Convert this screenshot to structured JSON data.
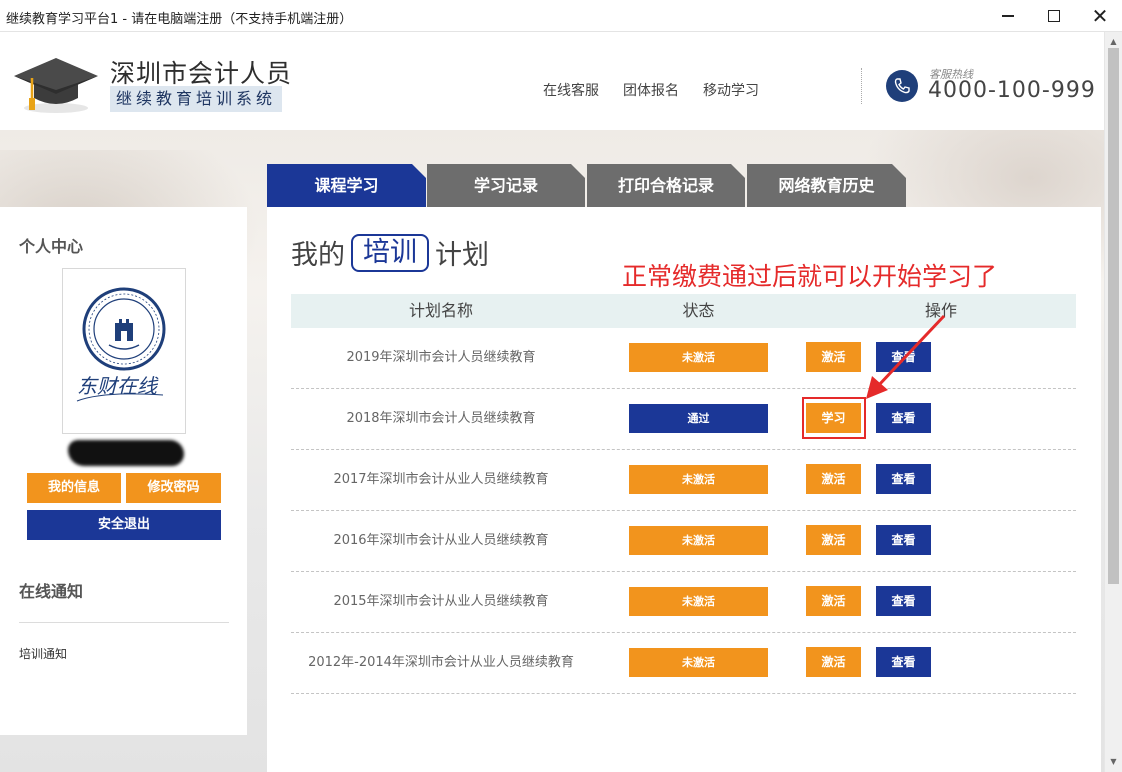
{
  "window": {
    "title": "继续教育学习平台1 - 请在电脑端注册（不支持手机端注册）"
  },
  "header": {
    "logo_title": "深圳市会计人员",
    "logo_subtitle": "继续教育培训系统",
    "nav": [
      "在线客服",
      "团体报名",
      "移动学习"
    ],
    "hotline_label": "客服热线",
    "hotline_number": "4000-100-999"
  },
  "tabs": [
    {
      "label": "课程学习",
      "active": true
    },
    {
      "label": "学习记录",
      "active": false
    },
    {
      "label": "打印合格记录",
      "active": false
    },
    {
      "label": "网络教育历史",
      "active": false
    }
  ],
  "sidebar": {
    "heading": "个人中心",
    "avatar_text": "东财在线",
    "buttons": {
      "my_info": "我的信息",
      "change_password": "修改密码",
      "logout": "安全退出"
    },
    "notice_heading": "在线通知",
    "notice_link": "培训通知"
  },
  "main": {
    "title_prefix": "我的",
    "title_boxed": "培训",
    "title_suffix": "计划",
    "annotation": "正常缴费通过后就可以开始学习了",
    "columns": [
      "计划名称",
      "状态",
      "操作"
    ],
    "rows": [
      {
        "name": "2019年深圳市会计人员继续教育",
        "status": "未激活",
        "action": "激活",
        "view": "查看"
      },
      {
        "name": "2018年深圳市会计人员继续教育",
        "status": "通过",
        "action": "学习",
        "view": "查看"
      },
      {
        "name": "2017年深圳市会计从业人员继续教育",
        "status": "未激活",
        "action": "激活",
        "view": "查看"
      },
      {
        "name": "2016年深圳市会计从业人员继续教育",
        "status": "未激活",
        "action": "激活",
        "view": "查看"
      },
      {
        "name": "2015年深圳市会计从业人员继续教育",
        "status": "未激活",
        "action": "激活",
        "view": "查看"
      },
      {
        "name": "2012年-2014年深圳市会计从业人员继续教育",
        "status": "未激活",
        "action": "激活",
        "view": "查看"
      }
    ]
  },
  "colors": {
    "navy": "#1b3797",
    "orange": "#f2941d",
    "annotation_red": "#e52a2a"
  }
}
